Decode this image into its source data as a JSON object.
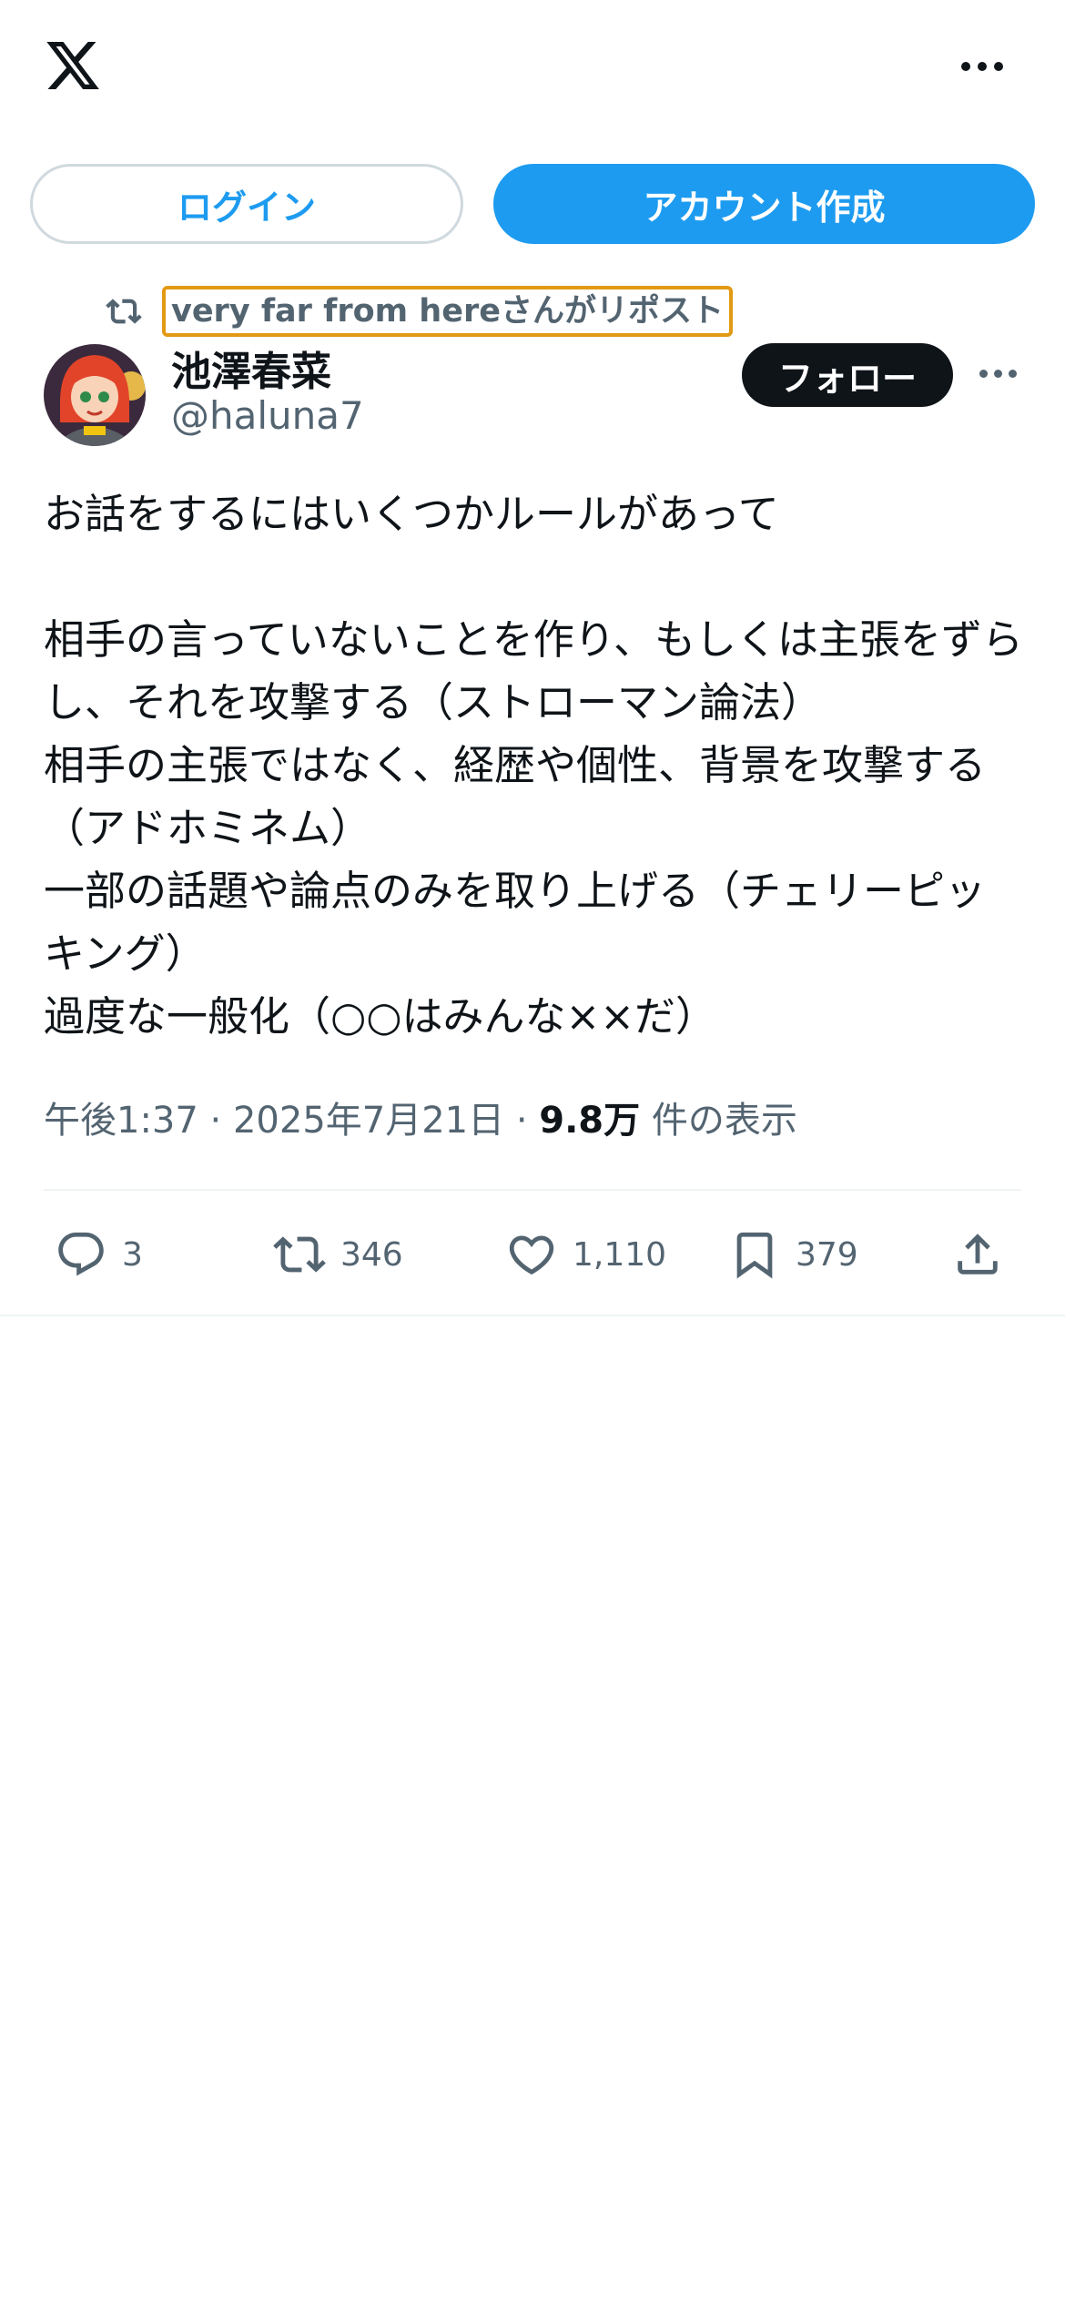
{
  "header": {
    "logo_icon": "x-logo-icon",
    "more_icon": "more-horizontal-icon"
  },
  "auth": {
    "login_label": "ログイン",
    "signup_label": "アカウント作成"
  },
  "repost": {
    "text": "very far from hereさんがリポスト",
    "icon": "repost-icon"
  },
  "author": {
    "name": "池澤春菜",
    "handle": "@haluna7",
    "follow_label": "フォロー"
  },
  "post": {
    "text": "お話をするにはいくつかルールがあって\n\n相手の言っていないことを作り、もしくは主張をずらし、それを攻撃する（ストローマン論法）\n相手の主張ではなく、経歴や個性、背景を攻撃する（アドホミネム）\n一部の話題や論点のみを取り上げる（チェリーピッキング）\n過度な一般化（○○はみんな××だ）",
    "time": "午後1:37 · 2025年7月21日 · ",
    "views_count": "9.8万",
    "views_label": " 件の表示"
  },
  "actions": {
    "replies": "3",
    "reposts": "346",
    "likes": "1,110",
    "bookmarks": "379"
  },
  "colors": {
    "accent": "#1d9bf0",
    "text": "#0f1419",
    "muted": "#536471",
    "highlight": "#e29a14"
  }
}
